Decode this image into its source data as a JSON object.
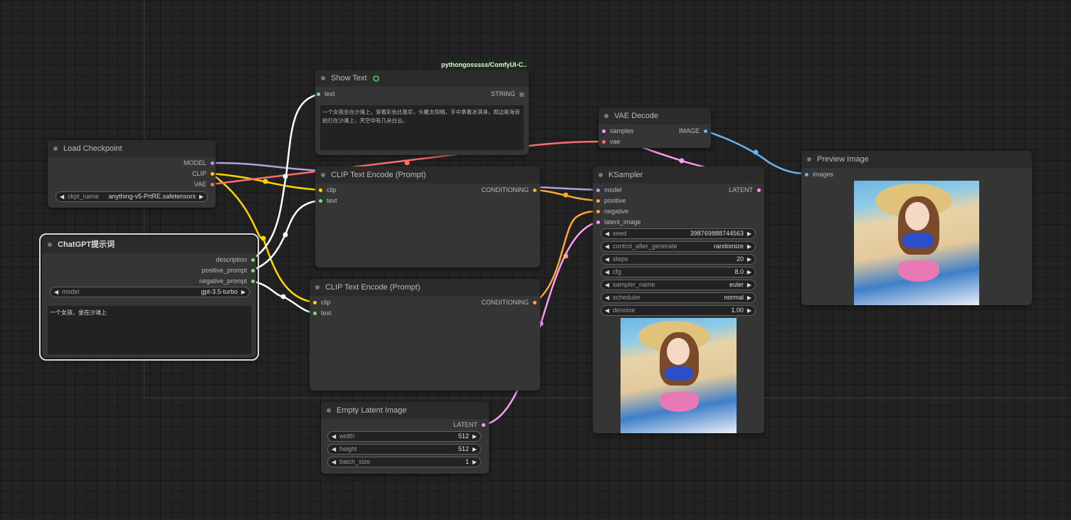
{
  "source_badge": "pythongosssss/ComfyUI-C..",
  "colors": {
    "background": "#222222",
    "node_body": "#353535",
    "node_title": "#2b2b2b",
    "link_model": "#b39ddb",
    "link_clip": "#ffd500",
    "link_vae": "#ff6e6e",
    "link_conditioning": "#ffa931",
    "link_latent": "#ff9cf9",
    "link_image": "#64b5f6",
    "link_string": "#ffffff"
  },
  "nodes": {
    "load_checkpoint": {
      "title": "Load Checkpoint",
      "outputs": [
        "MODEL",
        "CLIP",
        "VAE"
      ],
      "ckpt_name_label": "ckpt_name",
      "ckpt_name_value": "anything-v5-PrtRE.safetensors"
    },
    "chatgpt": {
      "title": "ChatGPT提示词",
      "outputs": [
        "description",
        "positive_prompt",
        "negative_prompt"
      ],
      "model_label": "model",
      "model_value": "gpt-3.5-turbo",
      "prompt_text": "一个女孩，坐在沙滩上"
    },
    "show_text": {
      "title": "Show Text",
      "icon": "python-snake-icon",
      "input": "text",
      "output": "STRING",
      "content": "一个女孩坐在沙滩上，穿着彩色比基尼，头戴太阳帽，手中拿着冰淇淋，周边是海浪拍打在沙滩上，天空中有几朵白云。"
    },
    "clip_encode_pos": {
      "title": "CLIP Text Encode (Prompt)",
      "inputs": [
        "clip",
        "text"
      ],
      "output": "CONDITIONING"
    },
    "clip_encode_neg": {
      "title": "CLIP Text Encode (Prompt)",
      "inputs": [
        "clip",
        "text"
      ],
      "output": "CONDITIONING"
    },
    "vae_decode": {
      "title": "VAE Decode",
      "inputs": [
        "samples",
        "vae"
      ],
      "output": "IMAGE"
    },
    "ksampler": {
      "title": "KSampler",
      "inputs": [
        "model",
        "positive",
        "negative",
        "latent_image"
      ],
      "output": "LATENT",
      "widgets": [
        {
          "name": "seed",
          "value": "398769888744563"
        },
        {
          "name": "control_after_generate",
          "value": "randomize"
        },
        {
          "name": "steps",
          "value": "20"
        },
        {
          "name": "cfg",
          "value": "8.0"
        },
        {
          "name": "sampler_name",
          "value": "euler"
        },
        {
          "name": "scheduler",
          "value": "normal"
        },
        {
          "name": "denoise",
          "value": "1.00"
        }
      ]
    },
    "preview_image": {
      "title": "Preview Image",
      "input": "images"
    },
    "empty_latent": {
      "title": "Empty Latent Image",
      "output": "LATENT",
      "widgets": [
        {
          "name": "width",
          "value": "512"
        },
        {
          "name": "height",
          "value": "512"
        },
        {
          "name": "batch_size",
          "value": "1"
        }
      ]
    }
  }
}
